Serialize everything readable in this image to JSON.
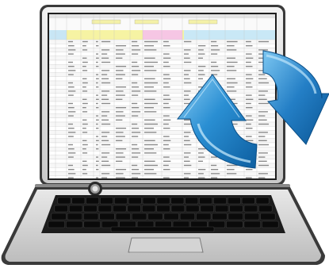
{
  "illustration": {
    "subject": "laptop-with-spreadsheet-and-sync-arrows",
    "icons": [
      "laptop-icon",
      "spreadsheet-icon",
      "sync-arrows-icon",
      "keyboard-icon",
      "touchpad-icon"
    ],
    "colors": {
      "laptop_body": "#d9d9d9",
      "laptop_frame": "#2a2a2a",
      "screen_bg": "#f4f4f4",
      "sheet_header": "#f4f1a8",
      "sheet_subheader": "#c8e6f5",
      "sheet_pink": "#f6c6e4",
      "arrow_blue": "#1d7fc4",
      "keyboard": "#1e1e1e"
    }
  }
}
